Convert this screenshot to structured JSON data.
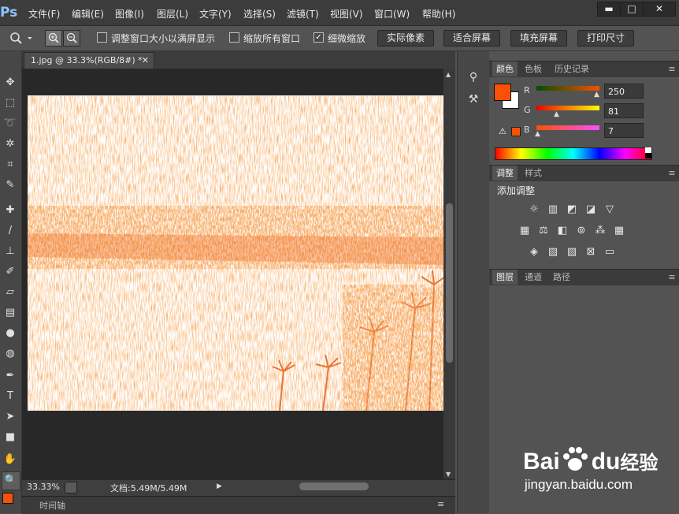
{
  "app": {
    "logo": "Ps"
  },
  "menu": [
    "文件(F)",
    "编辑(E)",
    "图像(I)",
    "图层(L)",
    "文字(Y)",
    "选择(S)",
    "滤镜(T)",
    "视图(V)",
    "窗口(W)",
    "帮助(H)"
  ],
  "window_controls": {
    "minimize": "▬",
    "restore": "□",
    "close": "✕"
  },
  "options": {
    "check_resize": {
      "label": "调整窗口大小以满屏显示",
      "checked": false
    },
    "check_all_windows": {
      "label": "缩放所有窗口",
      "checked": false
    },
    "check_scrubby": {
      "label": "细微缩放",
      "checked": true
    },
    "btn_actual": "实际像素",
    "btn_fit": "适合屏幕",
    "btn_fill": "填充屏幕",
    "btn_print": "打印尺寸"
  },
  "document": {
    "tab_title": "1.jpg @ 33.3%(RGB/8#) *",
    "zoom": "33.33%",
    "doc_info": "文档:5.49M/5.49M",
    "timeline_label": "时间轴"
  },
  "color_panel": {
    "tabs": [
      "颜色",
      "色板",
      "历史记录"
    ],
    "channels": [
      {
        "name": "R",
        "value": "250",
        "fraction": 0.98
      },
      {
        "name": "G",
        "value": "81",
        "fraction": 0.32
      },
      {
        "name": "B",
        "value": "7",
        "fraction": 0.03
      }
    ],
    "foreground": "#fa5107",
    "background": "#ffffff"
  },
  "adjust_panel": {
    "tabs": [
      "调整",
      "样式"
    ],
    "title": "添加调整"
  },
  "layers_panel": {
    "tabs": [
      "图层",
      "通道",
      "路径"
    ]
  },
  "watermark": {
    "brand_left": "Bai",
    "brand_mid": "du",
    "brand_right": "经验",
    "url": "jingyan.baidu.com"
  },
  "colors": {
    "accent": "#f06a20"
  }
}
